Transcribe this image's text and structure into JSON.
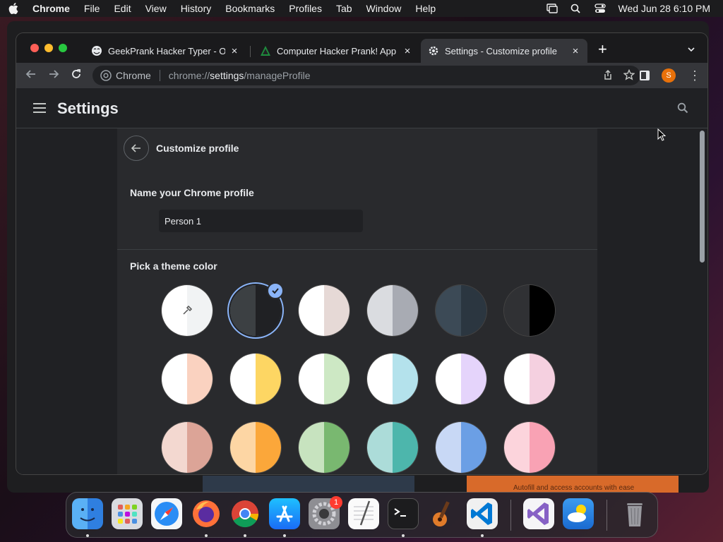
{
  "menubar": {
    "app_name": "Chrome",
    "items": [
      "File",
      "Edit",
      "View",
      "History",
      "Bookmarks",
      "Profiles",
      "Tab",
      "Window",
      "Help"
    ],
    "clock": "Wed Jun 28  6:10 PM"
  },
  "tabs": [
    {
      "label": "GeekPrank Hacker Typer - Onli",
      "icon": "troll-face-icon",
      "active": false
    },
    {
      "label": "Computer Hacker Prank! App -",
      "icon": "hacker-app-icon",
      "active": false
    },
    {
      "label": "Settings - Customize profile",
      "icon": "gear-icon",
      "active": true
    }
  ],
  "omnibox": {
    "chip": "Chrome",
    "url_scheme": "chrome://",
    "url_host": "settings",
    "url_path": "/manageProfile"
  },
  "profile": {
    "avatar_letter": "S",
    "avatar_color": "#e8710a"
  },
  "settings": {
    "title": "Settings",
    "subpage_title": "Customize profile",
    "name_section_label": "Name your Chrome profile",
    "profile_name": "Person 1",
    "theme_section_label": "Pick a theme color"
  },
  "theme_colors": [
    {
      "name": "custom-picker",
      "left": "#ffffff",
      "right": "#f1f3f4",
      "selected": false
    },
    {
      "name": "default-dark",
      "left": "#3c4043",
      "right": "#202124",
      "selected": true
    },
    {
      "name": "warm-grey",
      "left": "#ffffff",
      "right": "#e6d9d6",
      "selected": false
    },
    {
      "name": "cool-grey",
      "left": "#dadce0",
      "right": "#a8abb3",
      "selected": false
    },
    {
      "name": "midnight-blue",
      "left": "#3c4a56",
      "right": "#2b3640",
      "selected": false
    },
    {
      "name": "black",
      "left": "#303134",
      "right": "#000000",
      "selected": false
    },
    {
      "name": "beige-white",
      "left": "#ffffff",
      "right": "#fad2c0",
      "selected": false
    },
    {
      "name": "yellow-white",
      "left": "#ffffff",
      "right": "#fdd663",
      "selected": false
    },
    {
      "name": "green-white",
      "left": "#ffffff",
      "right": "#cde8c4",
      "selected": false
    },
    {
      "name": "light-teal-white",
      "left": "#ffffff",
      "right": "#b4e2ec",
      "selected": false
    },
    {
      "name": "light-purple-white",
      "left": "#ffffff",
      "right": "#e5d4fb",
      "selected": false
    },
    {
      "name": "pink-white",
      "left": "#ffffff",
      "right": "#f5d0e0",
      "selected": false
    },
    {
      "name": "beige",
      "left": "#f3d8d0",
      "right": "#dca497",
      "selected": false
    },
    {
      "name": "orange",
      "left": "#fdd6a4",
      "right": "#fba73a",
      "selected": false
    },
    {
      "name": "light-green",
      "left": "#c7e3bf",
      "right": "#79b870",
      "selected": false
    },
    {
      "name": "teal",
      "left": "#acdcd9",
      "right": "#4db6ac",
      "selected": false
    },
    {
      "name": "light-blue",
      "left": "#c8d8f5",
      "right": "#6b9fe5",
      "selected": false
    },
    {
      "name": "pink",
      "left": "#fcd4dc",
      "right": "#f9a2b4",
      "selected": false
    }
  ],
  "dock": {
    "apps": [
      "finder-icon",
      "launchpad-icon",
      "safari-icon",
      "firefox-icon",
      "chrome-icon",
      "app-store-icon",
      "system-settings-icon",
      "textedit-icon",
      "terminal-icon",
      "garageband-icon",
      "vscode-icon",
      "visual-studio-icon",
      "weather-icon",
      "trash-icon"
    ],
    "settings_badge": "1"
  },
  "background": {
    "partial_text": "Autofill and access accounts with ease"
  }
}
